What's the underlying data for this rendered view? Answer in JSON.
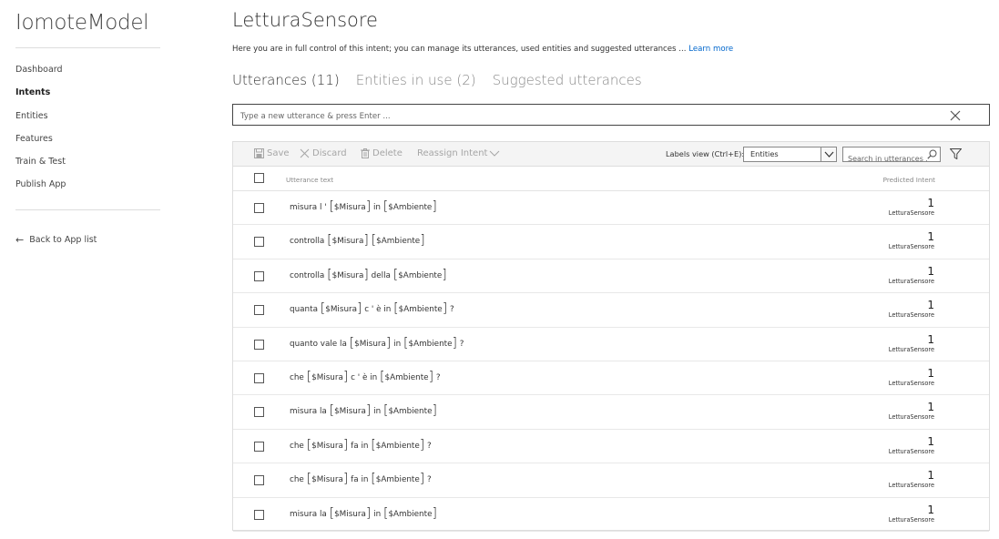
{
  "app": {
    "title": "IomoteModel"
  },
  "sidebar": {
    "items": [
      {
        "label": "Dashboard"
      },
      {
        "label": "Intents",
        "active": true
      },
      {
        "label": "Entities"
      },
      {
        "label": "Features"
      },
      {
        "label": "Train & Test"
      },
      {
        "label": "Publish App"
      }
    ],
    "back_label": "Back to App list",
    "back_icon": "arrow-left-icon"
  },
  "intent": {
    "title": "LetturaSensore",
    "description": "Here you are in full control of this intent; you can manage its utterances, used entities and suggested utterances ...",
    "learn_more": "Learn more"
  },
  "tabs": [
    {
      "label": "Utterances (11)",
      "active": true
    },
    {
      "label": "Entities in use (2)"
    },
    {
      "label": "Suggested utterances"
    }
  ],
  "new_utterance": {
    "placeholder": "Type a new utterance & press Enter ...",
    "value": ""
  },
  "toolbar": {
    "save": "Save",
    "discard": "Discard",
    "delete": "Delete",
    "reassign": "Reassign Intent",
    "labels_view_label": "Labels view (Ctrl+E):",
    "labels_view_value": "Entities",
    "search_placeholder": "Search in utterances ...",
    "disabled_color": "#a6a6a6"
  },
  "table": {
    "col_utterance": "Utterance text",
    "col_predicted": "Predicted Intent",
    "rows": [
      {
        "segments": [
          {
            "t": "misura l ' "
          },
          {
            "e": "$Misura"
          },
          {
            "t": " in "
          },
          {
            "e": "$Ambiente"
          }
        ],
        "score": "1",
        "intent": "LetturaSensore"
      },
      {
        "segments": [
          {
            "t": "controlla "
          },
          {
            "e": "$Misura"
          },
          {
            "t": " "
          },
          {
            "e": "$Ambiente"
          }
        ],
        "score": "1",
        "intent": "LetturaSensore"
      },
      {
        "segments": [
          {
            "t": "controlla "
          },
          {
            "e": "$Misura"
          },
          {
            "t": " della "
          },
          {
            "e": "$Ambiente"
          }
        ],
        "score": "1",
        "intent": "LetturaSensore"
      },
      {
        "segments": [
          {
            "t": "quanta "
          },
          {
            "e": "$Misura"
          },
          {
            "t": " c ' è in "
          },
          {
            "e": "$Ambiente"
          },
          {
            "t": " ?"
          }
        ],
        "score": "1",
        "intent": "LetturaSensore"
      },
      {
        "segments": [
          {
            "t": "quanto vale la "
          },
          {
            "e": "$Misura"
          },
          {
            "t": " in "
          },
          {
            "e": "$Ambiente"
          },
          {
            "t": " ?"
          }
        ],
        "score": "1",
        "intent": "LetturaSensore"
      },
      {
        "segments": [
          {
            "t": "che "
          },
          {
            "e": "$Misura"
          },
          {
            "t": " c ' è in "
          },
          {
            "e": "$Ambiente"
          },
          {
            "t": " ?"
          }
        ],
        "score": "1",
        "intent": "LetturaSensore"
      },
      {
        "segments": [
          {
            "t": "misura la "
          },
          {
            "e": "$Misura"
          },
          {
            "t": " in "
          },
          {
            "e": "$Ambiente"
          }
        ],
        "score": "1",
        "intent": "LetturaSensore"
      },
      {
        "segments": [
          {
            "t": "che "
          },
          {
            "e": "$Misura"
          },
          {
            "t": " fa in "
          },
          {
            "e": "$Ambiente"
          },
          {
            "t": " ?"
          }
        ],
        "score": "1",
        "intent": "LetturaSensore"
      },
      {
        "segments": [
          {
            "t": "che "
          },
          {
            "e": "$Misura"
          },
          {
            "t": " fa in "
          },
          {
            "e": "$Ambiente"
          },
          {
            "t": " ?"
          }
        ],
        "score": "1",
        "intent": "LetturaSensore"
      },
      {
        "segments": [
          {
            "t": "misura la "
          },
          {
            "e": "$Misura"
          },
          {
            "t": " in "
          },
          {
            "e": "$Ambiente"
          }
        ],
        "score": "1",
        "intent": "LetturaSensore"
      }
    ]
  },
  "colors": {
    "link": "#0066cc",
    "text": "#333333",
    "muted": "#888888"
  }
}
